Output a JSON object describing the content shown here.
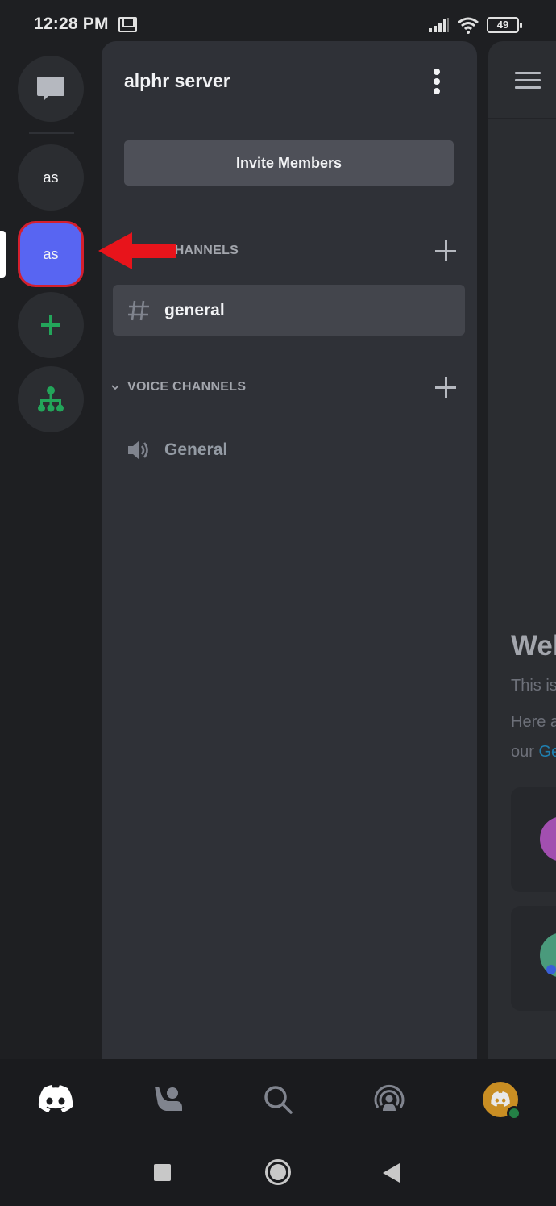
{
  "status_bar": {
    "time": "12:28 PM",
    "notification_icon": "gmail-icon",
    "signal_icon": "cellular-signal-icon",
    "wifi_icon": "wifi-icon",
    "battery_level": "49"
  },
  "server_rail": {
    "items": [
      {
        "name": "direct-messages",
        "icon": "chat-bubble-icon",
        "label": ""
      },
      {
        "name": "server-as-1",
        "label": "as"
      },
      {
        "name": "server-as-2",
        "label": "as",
        "selected": true
      },
      {
        "name": "add-server",
        "icon": "plus-icon",
        "label": ""
      },
      {
        "name": "explore-servers",
        "icon": "hierarchy-icon",
        "label": ""
      }
    ]
  },
  "channels_panel": {
    "server_name": "alphr server",
    "menu_icon": "kebab-menu-icon",
    "invite_button": "Invite Members",
    "categories": [
      {
        "label": "TEXT CHANNELS",
        "channels": [
          {
            "name": "general",
            "type": "text",
            "selected": true
          }
        ]
      },
      {
        "label": "VOICE CHANNELS",
        "channels": [
          {
            "name": "General",
            "type": "voice"
          }
        ]
      }
    ]
  },
  "chat_panel": {
    "menu_icon": "hamburger-icon",
    "welcome_title": "Welcome to",
    "line1": "This is",
    "line2": "Here are",
    "line3_prefix": "our ",
    "line3_link": "Getting"
  },
  "bottom_nav": {
    "items": [
      {
        "name": "home",
        "icon": "discord-logo-icon",
        "active": true
      },
      {
        "name": "friends",
        "icon": "friends-wave-icon"
      },
      {
        "name": "search",
        "icon": "search-icon"
      },
      {
        "name": "mentions",
        "icon": "broadcast-user-icon"
      },
      {
        "name": "profile",
        "icon": "avatar-icon",
        "status": "online"
      }
    ]
  },
  "system_nav": {
    "recents": "recents-icon",
    "home": "home-icon",
    "back": "back-icon"
  },
  "colors": {
    "brand": "#5865f2",
    "green": "#23a55a",
    "annotation": "#e8141b",
    "avatar_bg": "#c98e23"
  }
}
